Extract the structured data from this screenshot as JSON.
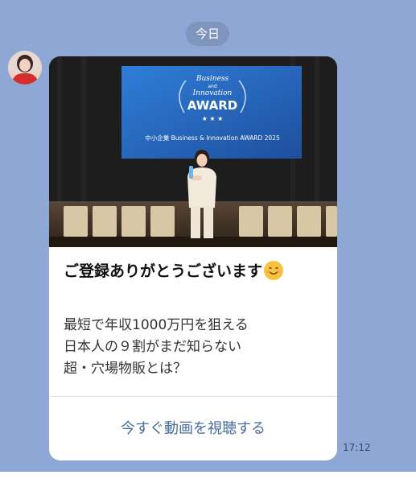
{
  "chat": {
    "date_chip": "今日"
  },
  "message": {
    "sender_avatar_icon": "profile-photo",
    "banner": {
      "logo_lines": [
        "Business",
        "and",
        "Innovation"
      ],
      "award_word": "AWARD",
      "screen_caption": "中小企業 Business & Innovation AWARD 2025"
    },
    "title": "ご登録ありがとうございます",
    "title_emoji": "smiling-face-emoji",
    "body_lines": [
      "最短で年収1000万円を狙える",
      "日本人の９割がまだ知らない",
      "超・穴場物販とは？"
    ],
    "action_label": "今すぐ動画を視聴する",
    "time": "17:12"
  },
  "colors": {
    "chat_background": "#8fa7d4",
    "action_text": "#4a6d9c",
    "stage_screen": "#2f6fc6"
  }
}
